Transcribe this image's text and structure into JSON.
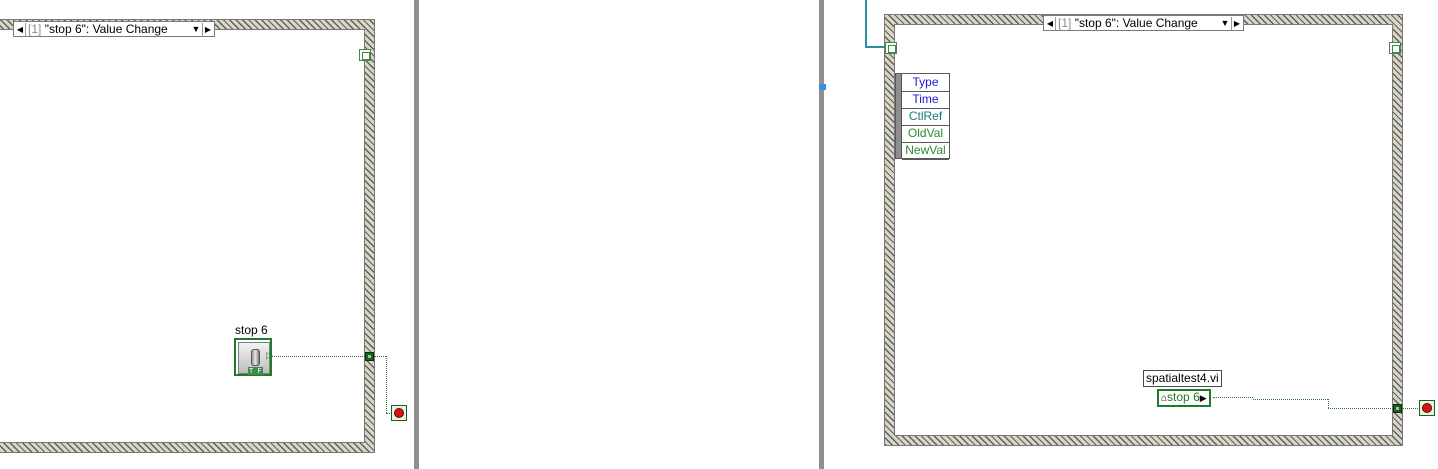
{
  "left_panel": {
    "selector": {
      "index": "[1]",
      "label": "\"stop 6\": Value Change"
    },
    "control_label": "stop 6",
    "control_tf": "T F"
  },
  "right_panel": {
    "selector": {
      "index": "[1]",
      "label": "\"stop 6\": Value Change"
    },
    "event_data_fields": [
      {
        "label": "Type",
        "color": "#1a1ad6"
      },
      {
        "label": "Time",
        "color": "#1a1ad6"
      },
      {
        "label": "CtlRef",
        "color": "#1a7a7a"
      },
      {
        "label": "OldVal",
        "color": "#2e8a2e"
      },
      {
        "label": "NewVal",
        "color": "#2e8a2e"
      }
    ],
    "vi_name": "spatialtest4.vi",
    "global_ref": "stop 6"
  },
  "colors": {
    "wire_green": "#2f7a2f",
    "wire_blue": "#2c8ea2",
    "stop_red": "#d11414",
    "accent_green": "#1f7a2a"
  }
}
